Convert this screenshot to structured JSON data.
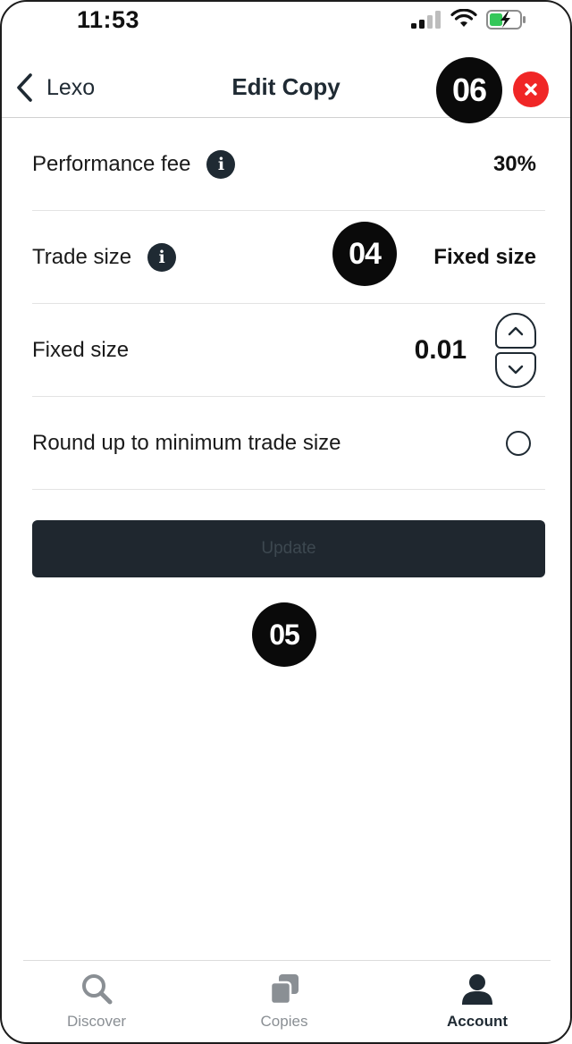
{
  "status_bar": {
    "time": "11:53"
  },
  "nav": {
    "back_label": "Lexo",
    "title": "Edit Copy"
  },
  "rows": {
    "performance_fee": {
      "label": "Performance fee",
      "value": "30%"
    },
    "trade_size": {
      "label": "Trade size",
      "value": "Fixed size"
    },
    "fixed_size": {
      "label": "Fixed size",
      "value": "0.01"
    },
    "round_up": {
      "label": "Round up to minimum trade size",
      "checked": false
    }
  },
  "update_button": {
    "label": "Update"
  },
  "markers": {
    "m04": "04",
    "m05": "05",
    "m06": "06"
  },
  "tabs": [
    {
      "label": "Discover",
      "icon": "search-icon",
      "active": false
    },
    {
      "label": "Copies",
      "icon": "copies-icon",
      "active": false
    },
    {
      "label": "Account",
      "icon": "person-icon",
      "active": true
    }
  ],
  "colors": {
    "close_red": "#f02626",
    "dark": "#1f2a33",
    "button_bg": "#1f272f",
    "battery_green": "#34c759"
  }
}
